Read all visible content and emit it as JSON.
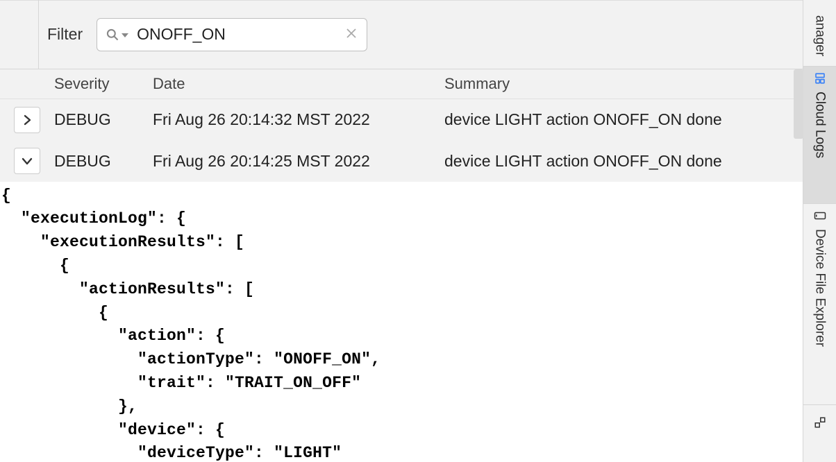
{
  "filter": {
    "label": "Filter",
    "value": "ONOFF_ON"
  },
  "columns": {
    "severity": "Severity",
    "date": "Date",
    "summary": "Summary"
  },
  "logs": [
    {
      "expanded": false,
      "severity": "DEBUG",
      "date": "Fri Aug 26 20:14:32 MST 2022",
      "summary": "device LIGHT action ONOFF_ON done"
    },
    {
      "expanded": true,
      "severity": "DEBUG",
      "date": "Fri Aug 26 20:14:25 MST 2022",
      "summary": "device LIGHT action ONOFF_ON done"
    }
  ],
  "detail_json": "{\n  \"executionLog\": {\n    \"executionResults\": [\n      {\n        \"actionResults\": [\n          {\n            \"action\": {\n              \"actionType\": \"ONOFF_ON\",\n              \"trait\": \"TRAIT_ON_OFF\"\n            },\n            \"device\": {\n              \"deviceType\": \"LIGHT\"",
  "side_tabs": {
    "top_partial": "anager",
    "cloud": "Cloud Logs",
    "device": "Device File Explorer"
  }
}
